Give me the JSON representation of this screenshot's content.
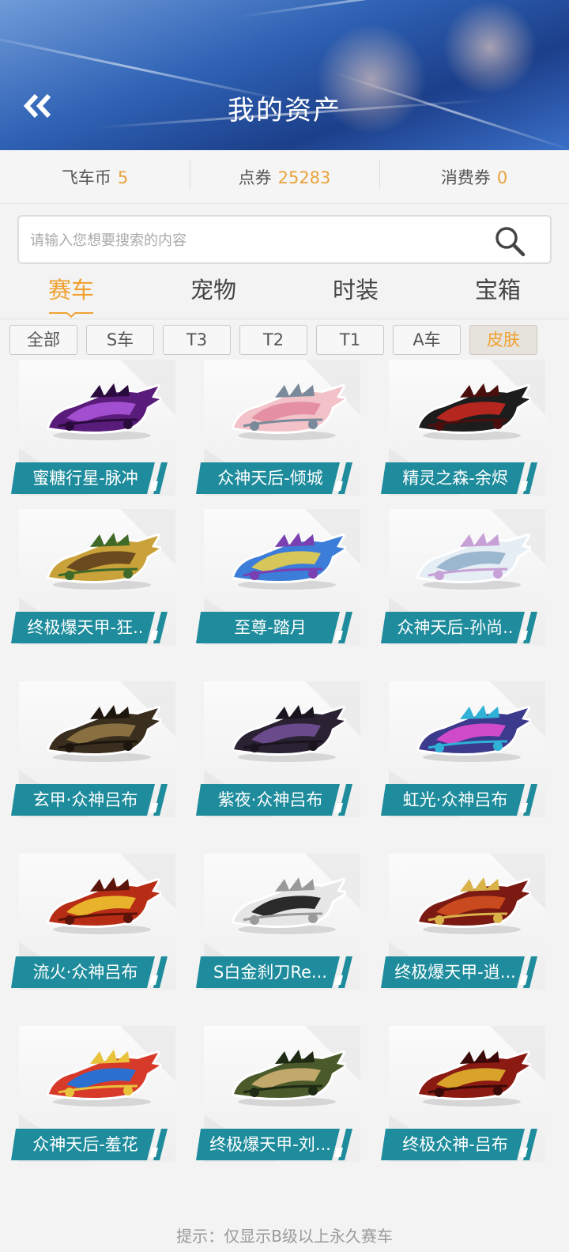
{
  "header": {
    "title": "我的资产",
    "back_icon": "double-chevron-left-icon"
  },
  "balances": [
    {
      "label": "飞车币",
      "value": "5"
    },
    {
      "label": "点券",
      "value": "25283"
    },
    {
      "label": "消费券",
      "value": "0"
    }
  ],
  "search": {
    "placeholder": "请输入您想要搜索的内容",
    "icon": "search-icon"
  },
  "tabs": [
    {
      "label": "赛车",
      "active": true
    },
    {
      "label": "宠物",
      "active": false
    },
    {
      "label": "时装",
      "active": false
    },
    {
      "label": "宝箱",
      "active": false
    }
  ],
  "filters": [
    {
      "label": "全部",
      "active": false
    },
    {
      "label": "S车",
      "active": false
    },
    {
      "label": "T3",
      "active": false
    },
    {
      "label": "T2",
      "active": false
    },
    {
      "label": "T1",
      "active": false
    },
    {
      "label": "A车",
      "active": false
    },
    {
      "label": "皮肤",
      "active": true
    }
  ],
  "items": [
    {
      "name": "蜜糖行星-脉冲",
      "colors": [
        "#5a1c7a",
        "#a24ed0",
        "#2a0b3d"
      ]
    },
    {
      "name": "众神天后-倾城",
      "colors": [
        "#f2c2c8",
        "#e58fa3",
        "#7a8a9a"
      ]
    },
    {
      "name": "精灵之森-余烬",
      "colors": [
        "#1d1d1d",
        "#b5261e",
        "#4a0f0c"
      ]
    },
    {
      "name": "终极爆天甲-狂..",
      "colors": [
        "#c9a23a",
        "#6a4a1e",
        "#3f6a2a"
      ]
    },
    {
      "name": "至尊-踏月",
      "colors": [
        "#3b7dd8",
        "#d7c65a",
        "#7a3fb0"
      ]
    },
    {
      "name": "众神天后-孙尚..",
      "colors": [
        "#e6eef5",
        "#9bb7d0",
        "#c7a0d6"
      ]
    },
    {
      "name": "玄甲·众神吕布",
      "colors": [
        "#3a2e1e",
        "#8a7040",
        "#1c160e"
      ]
    },
    {
      "name": "紫夜·众神吕布",
      "colors": [
        "#2a2233",
        "#6b4a8c",
        "#1a141f"
      ]
    },
    {
      "name": "虹光·众神吕布",
      "colors": [
        "#3c3a8c",
        "#d04bc9",
        "#2fb2d6"
      ]
    },
    {
      "name": "流火·众神吕布",
      "colors": [
        "#b72c14",
        "#e8b22a",
        "#5a140a"
      ]
    },
    {
      "name": "S白金刹刀Re...",
      "colors": [
        "#e6e6e6",
        "#2a2a2a",
        "#9a9a9a"
      ]
    },
    {
      "name": "终极爆天甲-逍...",
      "colors": [
        "#7a1a12",
        "#c94a1e",
        "#d9b24a"
      ]
    },
    {
      "name": "众神天后-羞花",
      "colors": [
        "#d83a2a",
        "#2b6fd0",
        "#e8c23a"
      ]
    },
    {
      "name": "终极爆天甲-刘...",
      "colors": [
        "#4a5a2a",
        "#c2a86a",
        "#1e2a14"
      ]
    },
    {
      "name": "终极众神-吕布",
      "colors": [
        "#8a1a12",
        "#d9a22a",
        "#3a0a08"
      ]
    }
  ],
  "tip": "提示：仅显示B级以上永久赛车",
  "colors": {
    "accent": "#f0a232",
    "label_teal": "#1e8c9c"
  }
}
